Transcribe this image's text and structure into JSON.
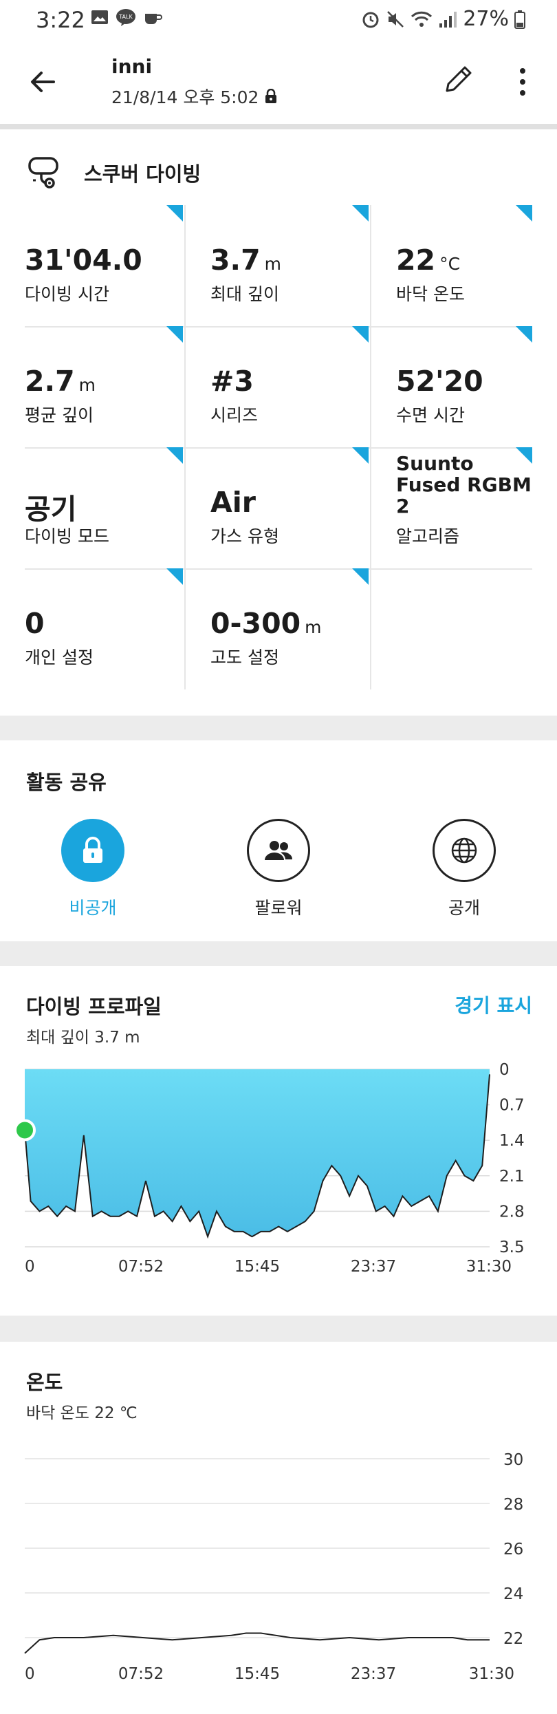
{
  "status": {
    "time": "3:22",
    "battery": "27%"
  },
  "header": {
    "title": "inni",
    "datetime": "21/8/14 오후 5:02"
  },
  "activity": {
    "name": "스쿠버 다이빙"
  },
  "metrics": [
    {
      "value": "31'04.0",
      "unit": "",
      "label": "다이빙 시간"
    },
    {
      "value": "3.7",
      "unit": "m",
      "label": "최대 깊이"
    },
    {
      "value": "22",
      "unit": "°C",
      "label": "바닥 온도"
    },
    {
      "value": "2.7",
      "unit": "m",
      "label": "평균 깊이"
    },
    {
      "value": "#3",
      "unit": "",
      "label": "시리즈"
    },
    {
      "value": "52'20",
      "unit": "",
      "label": "수면 시간"
    },
    {
      "value": "공기",
      "unit": "",
      "label": "다이빙 모드"
    },
    {
      "value": "Air",
      "unit": "",
      "label": "가스 유형"
    },
    {
      "value": "Suunto Fused RGBM 2",
      "unit": "",
      "label": "알고리즘"
    },
    {
      "value": "0",
      "unit": "",
      "label": "개인 설정"
    },
    {
      "value": "0-300",
      "unit": "m",
      "label": "고도 설정"
    }
  ],
  "share": {
    "title": "활동 공유",
    "options": [
      {
        "label": "비공개",
        "icon": "lock-icon",
        "active": true
      },
      {
        "label": "팔로워",
        "icon": "people-icon",
        "active": false
      },
      {
        "label": "공개",
        "icon": "globe-icon",
        "active": false
      }
    ]
  },
  "profile": {
    "title": "다이빙 프로파일",
    "subtitle": "최대 깊이 3.7 m",
    "link": "경기 표시"
  },
  "temperature": {
    "title": "온도",
    "subtitle": "바닥 온도 22 ℃"
  },
  "colors": {
    "accent": "#1aa5dd",
    "depth_fill_top": "#6cdcf5",
    "depth_fill_bottom": "#4bbde6",
    "start_marker": "#2ec84a"
  },
  "chart_data": [
    {
      "type": "area",
      "name": "dive-profile",
      "x_tick_labels": [
        "0",
        "07:52",
        "15:45",
        "23:37",
        "31:30"
      ],
      "y_tick_labels": [
        "0",
        "0.7",
        "1.4",
        "2.1",
        "2.8",
        "3.5"
      ],
      "ylim": [
        0,
        3.5
      ],
      "y_inverted": true,
      "xlim": [
        0,
        31.5
      ],
      "x": [
        0,
        0.4,
        1,
        1.6,
        2.2,
        2.8,
        3.4,
        4.0,
        4.6,
        5.2,
        5.8,
        6.4,
        7.0,
        7.6,
        8.2,
        8.8,
        9.4,
        10.0,
        10.6,
        11.2,
        11.8,
        12.4,
        13.0,
        13.6,
        14.2,
        14.8,
        15.4,
        16.0,
        16.6,
        17.2,
        17.8,
        18.4,
        19.0,
        19.6,
        20.2,
        20.8,
        21.4,
        22.0,
        22.6,
        23.2,
        23.8,
        24.4,
        25.0,
        25.6,
        26.2,
        26.8,
        27.4,
        28.0,
        28.6,
        29.2,
        29.8,
        30.4,
        31.0,
        31.5
      ],
      "values": [
        1.2,
        2.6,
        2.8,
        2.7,
        2.9,
        2.7,
        2.8,
        1.3,
        2.9,
        2.8,
        2.9,
        2.9,
        2.8,
        2.9,
        2.2,
        2.9,
        2.8,
        3.0,
        2.7,
        3.0,
        2.8,
        3.3,
        2.8,
        3.1,
        3.2,
        3.2,
        3.3,
        3.2,
        3.2,
        3.1,
        3.2,
        3.1,
        3.0,
        2.8,
        2.2,
        1.9,
        2.1,
        2.5,
        2.1,
        2.3,
        2.8,
        2.7,
        2.9,
        2.5,
        2.7,
        2.6,
        2.5,
        2.8,
        2.1,
        1.8,
        2.1,
        2.2,
        1.9,
        0.1
      ]
    },
    {
      "type": "line",
      "name": "temperature",
      "x_tick_labels": [
        "0",
        "07:52",
        "15:45",
        "23:37",
        "31:30"
      ],
      "y_tick_labels": [
        "30",
        "28",
        "26",
        "24",
        "22"
      ],
      "ylim": [
        21.2,
        30
      ],
      "xlim": [
        0,
        31.5
      ],
      "x": [
        0,
        1,
        2,
        4,
        6,
        8,
        10,
        12,
        14,
        15,
        16,
        18,
        20,
        22,
        24,
        26,
        28,
        29,
        30,
        31.5
      ],
      "values": [
        21.3,
        21.9,
        22.0,
        22.0,
        22.1,
        22.0,
        21.9,
        22.0,
        22.1,
        22.2,
        22.2,
        22.0,
        21.9,
        22.0,
        21.9,
        22.0,
        22.0,
        22.0,
        21.9,
        21.9
      ]
    }
  ]
}
